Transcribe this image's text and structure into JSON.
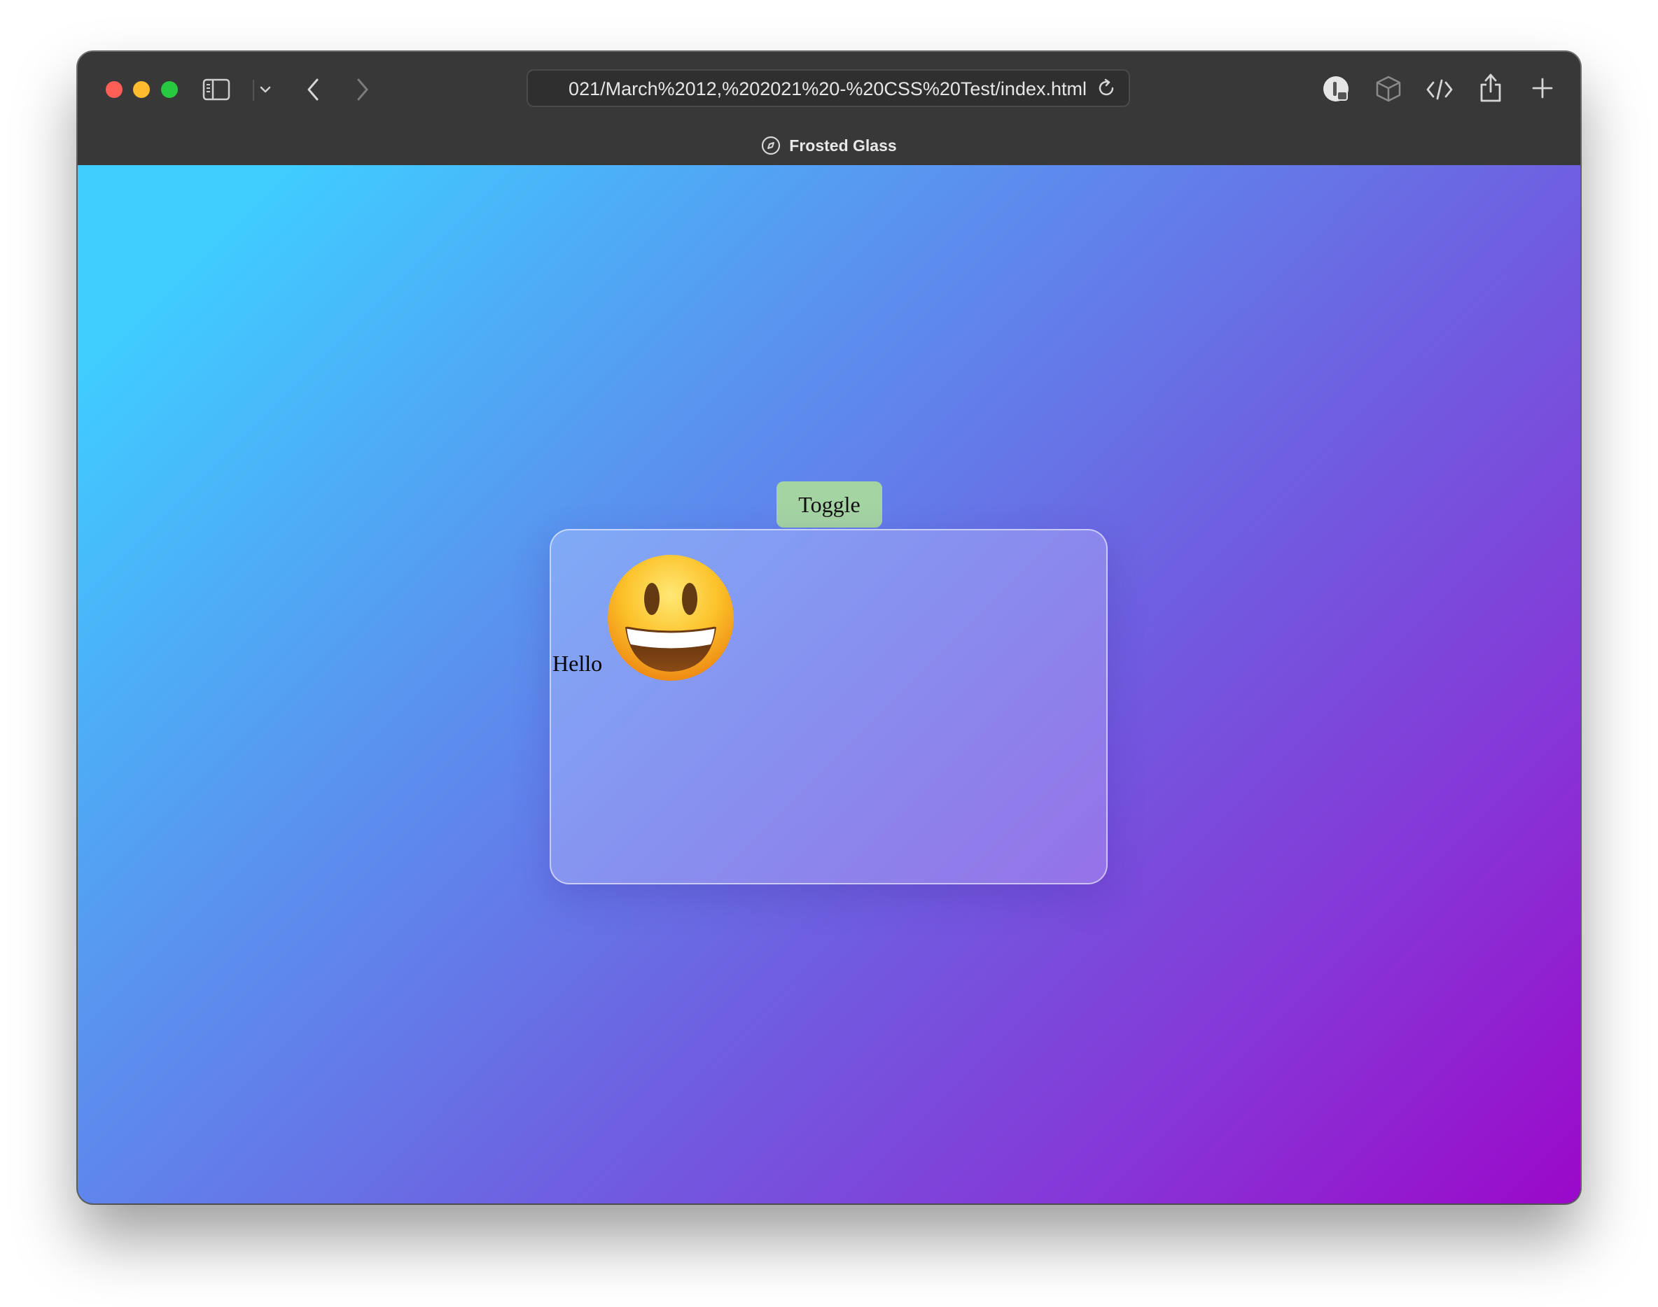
{
  "browser": {
    "url": "021/March%2012,%202021%20-%20CSS%20Test/index.html",
    "tab_title": "Frosted Glass",
    "icons": {
      "sidebar": "sidebar-icon",
      "sidebar_menu": "chevron-down-icon",
      "back": "back-arrow-icon",
      "forward": "forward-arrow-icon",
      "reload": "reload-icon",
      "extension": "extension-icon",
      "box": "box-icon",
      "developer": "code-icon",
      "share": "share-icon",
      "new_tab": "plus-icon",
      "tab_favicon": "compass-icon"
    }
  },
  "page": {
    "toggle_label": "Toggle",
    "hello_text": "Hello",
    "emoji": "smiley-face",
    "colors": {
      "toggle_bg": "#a5d4a3",
      "gradient_start": "#3fcdff",
      "gradient_end": "#9b08c9"
    }
  }
}
